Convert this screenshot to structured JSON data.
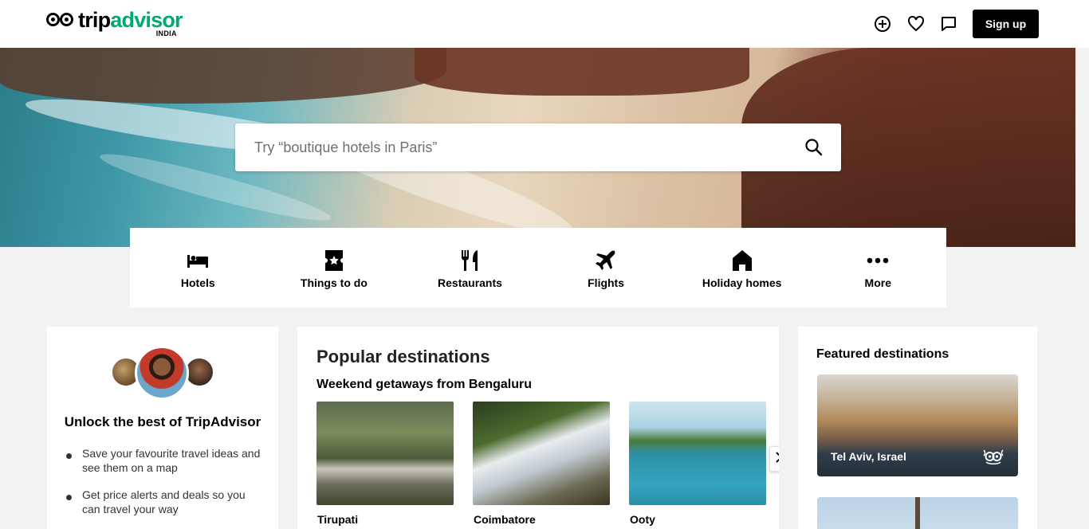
{
  "header": {
    "logo": {
      "brand_trip": "trip",
      "brand_advisor": "advisor",
      "region": "INDIA"
    },
    "icons": [
      "add-circle-icon",
      "heart-icon",
      "chat-icon"
    ],
    "signup_label": "Sign up"
  },
  "hero": {
    "search_placeholder": "Try “boutique hotels in Paris”"
  },
  "categories": [
    {
      "label": "Hotels",
      "icon": "bed-icon"
    },
    {
      "label": "Things to do",
      "icon": "ticket-star-icon"
    },
    {
      "label": "Restaurants",
      "icon": "fork-knife-icon"
    },
    {
      "label": "Flights",
      "icon": "plane-icon"
    },
    {
      "label": "Holiday homes",
      "icon": "house-icon"
    },
    {
      "label": "More",
      "icon": "more-dots-icon"
    }
  ],
  "unlock": {
    "title": "Unlock the best of TripAdvisor",
    "bullets": [
      "Save your favourite travel ideas and see them on a map",
      "Get price alerts and deals so you can travel your way"
    ]
  },
  "popular": {
    "title": "Popular destinations",
    "subtitle": "Weekend getaways from Bengaluru",
    "destinations": [
      {
        "name": "Tirupati"
      },
      {
        "name": "Coimbatore"
      },
      {
        "name": "Ooty"
      }
    ]
  },
  "featured": {
    "title": "Featured destinations",
    "items": [
      {
        "name": "Tel Aviv, Israel"
      }
    ]
  },
  "colors": {
    "brand_green": "#00aa6c",
    "button_black": "#000000",
    "page_background": "#f2f2f2"
  }
}
